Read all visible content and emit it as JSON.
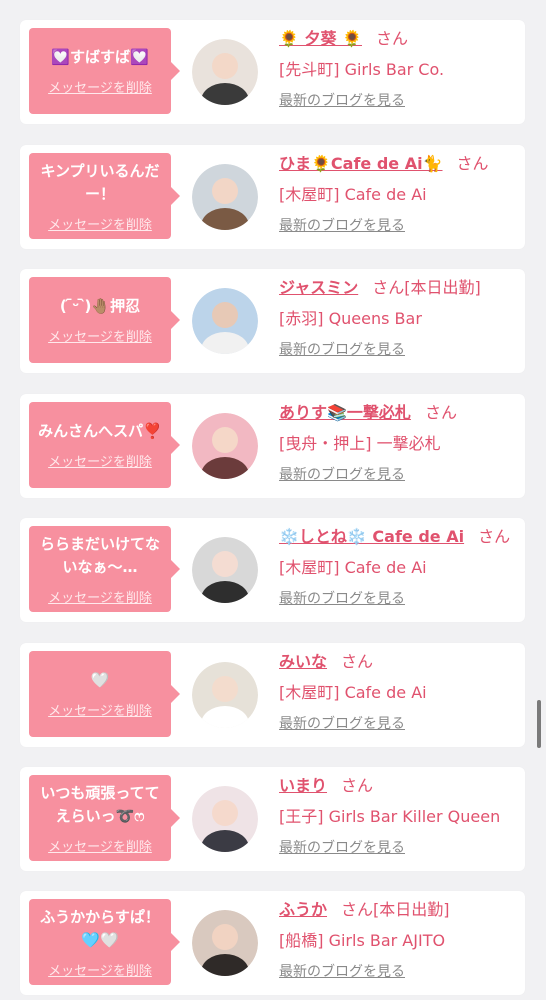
{
  "items": [
    {
      "message": "💟すばすば💟",
      "delete_label": "メッセージを削除",
      "name": "🌻 夕葵 🌻",
      "san": "さん",
      "status": "",
      "shop": "[先斗町] Girls Bar Co.",
      "blog_label": "最新のブログを見る"
    },
    {
      "message": "キンプリいるんだー！",
      "delete_label": "メッセージを削除",
      "name": "ひま🌻Cafe de Ai🐈",
      "san": "さん",
      "status": "",
      "shop": "[木屋町] Cafe de Ai",
      "blog_label": "最新のブログを見る"
    },
    {
      "message": "( ᷇ᵕ ᷆)🤚🏽押忍",
      "delete_label": "メッセージを削除",
      "name": "ジャスミン",
      "san": "さん",
      "status": "[本日出勤]",
      "shop": "[赤羽] Queens Bar",
      "blog_label": "最新のブログを見る"
    },
    {
      "message": "みんさんへスパ❣️",
      "delete_label": "メッセージを削除",
      "name": "ありす📚一撃必札",
      "san": "さん",
      "status": "",
      "shop": "[曳舟・押上] 一撃必札",
      "blog_label": "最新のブログを見る"
    },
    {
      "message": "ららまだいけてないなぁ〜…",
      "delete_label": "メッセージを削除",
      "name": "❄️しとね❄️ Cafe de Ai",
      "san": "さん",
      "status": "",
      "shop": "[木屋町] Cafe de Ai",
      "blog_label": "最新のブログを見る"
    },
    {
      "message": "🤍",
      "delete_label": "メッセージを削除",
      "name": "みいな",
      "san": "さん",
      "status": "",
      "shop": "[木屋町] Cafe de Ai",
      "blog_label": "最新のブログを見る"
    },
    {
      "message": "いつも頑張っててえらいっ➰ෆ",
      "delete_label": "メッセージを削除",
      "name": "いまり",
      "san": "さん",
      "status": "",
      "shop": "[王子] Girls Bar Killer Queen",
      "blog_label": "最新のブログを見る"
    },
    {
      "message": "ふうかからすぱ！🩵🤍",
      "delete_label": "メッセージを削除",
      "name": "ふうか",
      "san": "さん",
      "status": "[本日出勤]",
      "shop": "[船橋] Girls Bar AJITO",
      "blog_label": "最新のブログを見る"
    }
  ],
  "avatar_icons": [
    "avatar-photo-icon"
  ],
  "colors": {
    "bubble": "#f7909f",
    "accent_text": "#e0526e",
    "link_gray": "#8a8a8a",
    "background": "#f1f1f3"
  }
}
